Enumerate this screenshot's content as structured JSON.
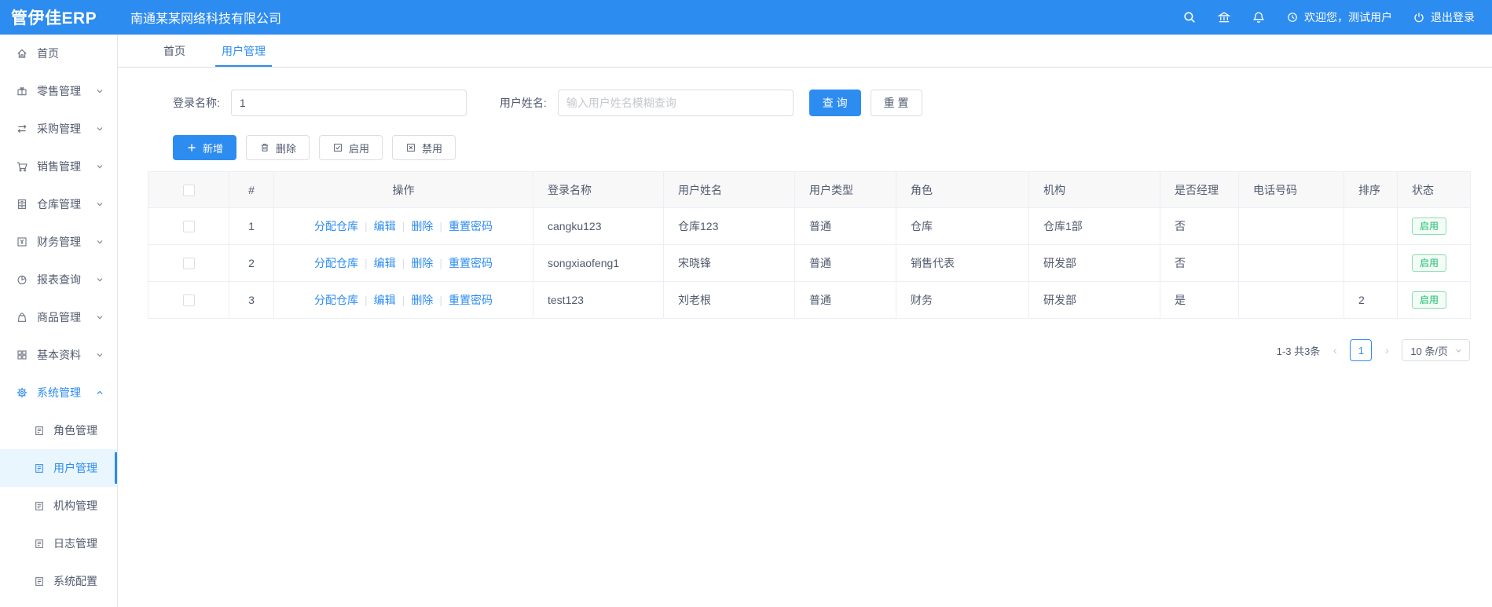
{
  "brand": {
    "logo": "管伊佳ERP",
    "company": "南通某某网络科技有限公司"
  },
  "header": {
    "welcome": "欢迎您，测试用户",
    "logout": "退出登录"
  },
  "colors": {
    "primary": "#2d8cf0",
    "success": "#19be6b"
  },
  "sidebar": {
    "items": [
      {
        "label": "首页",
        "icon": "home-icon"
      },
      {
        "label": "零售管理",
        "icon": "gift-icon"
      },
      {
        "label": "采购管理",
        "icon": "swap-icon"
      },
      {
        "label": "销售管理",
        "icon": "cart-icon"
      },
      {
        "label": "仓库管理",
        "icon": "cabinet-icon"
      },
      {
        "label": "财务管理",
        "icon": "finance-icon"
      },
      {
        "label": "报表查询",
        "icon": "pie-chart-icon"
      },
      {
        "label": "商品管理",
        "icon": "bag-icon"
      },
      {
        "label": "基本资料",
        "icon": "grid-icon"
      },
      {
        "label": "系统管理",
        "icon": "gear-icon"
      }
    ],
    "subitems": [
      {
        "label": "角色管理",
        "icon": "document-icon"
      },
      {
        "label": "用户管理",
        "icon": "document-icon"
      },
      {
        "label": "机构管理",
        "icon": "document-icon"
      },
      {
        "label": "日志管理",
        "icon": "document-icon"
      },
      {
        "label": "系统配置",
        "icon": "document-icon"
      }
    ]
  },
  "tabs": [
    {
      "label": "首页"
    },
    {
      "label": "用户管理"
    }
  ],
  "filters": {
    "login_label": "登录名称:",
    "login_value": "1",
    "name_label": "用户姓名:",
    "name_placeholder": "输入用户姓名模糊查询",
    "search_button": "查 询",
    "reset_button": "重 置"
  },
  "toolbar": {
    "add": "新增",
    "delete": "删除",
    "enable": "启用",
    "disable": "禁用"
  },
  "table": {
    "columns": [
      "#",
      "操作",
      "登录名称",
      "用户姓名",
      "用户类型",
      "角色",
      "机构",
      "是否经理",
      "电话号码",
      "排序",
      "状态"
    ],
    "ops": [
      "分配仓库",
      "编辑",
      "删除",
      "重置密码"
    ],
    "rows": [
      {
        "index": "1",
        "login": "cangku123",
        "name": "仓库123",
        "type": "普通",
        "role": "仓库",
        "org": "仓库1部",
        "manager": "否",
        "phone": "",
        "sort": "",
        "status": "启用"
      },
      {
        "index": "2",
        "login": "songxiaofeng1",
        "name": "宋晓锋",
        "type": "普通",
        "role": "销售代表",
        "org": "研发部",
        "manager": "否",
        "phone": "",
        "sort": "",
        "status": "启用"
      },
      {
        "index": "3",
        "login": "test123",
        "name": "刘老根",
        "type": "普通",
        "role": "财务",
        "org": "研发部",
        "manager": "是",
        "phone": "",
        "sort": "2",
        "status": "启用"
      }
    ]
  },
  "pagination": {
    "total": "1-3 共3条",
    "prev": "‹",
    "next": "›",
    "page": "1",
    "page_size": "10 条/页"
  }
}
